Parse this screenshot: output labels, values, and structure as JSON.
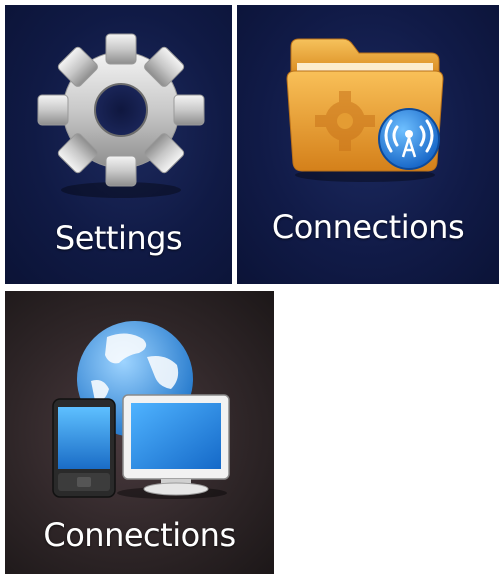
{
  "tiles": [
    {
      "label": "Settings",
      "icon": "gear-icon"
    },
    {
      "label": "Connections",
      "icon": "folder-wireless-icon"
    },
    {
      "label": "Connections",
      "icon": "globe-devices-icon"
    }
  ],
  "colors": {
    "tile_blue": "#101a45",
    "tile_dark_brown": "#2f2628",
    "label_text": "#ffffff",
    "folder_orange": "#f0a030",
    "badge_blue": "#1f7fe0"
  }
}
